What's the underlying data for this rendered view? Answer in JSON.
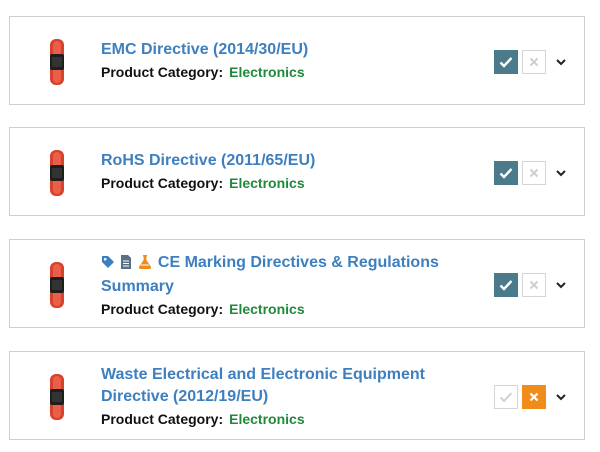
{
  "items": [
    {
      "title": "EMC Directive (2014/30/EU)",
      "category_label": "Product Category:",
      "category_value": "Electronics",
      "approved": true,
      "icons": []
    },
    {
      "title": "RoHS Directive (2011/65/EU)",
      "category_label": "Product Category:",
      "category_value": "Electronics",
      "approved": true,
      "icons": []
    },
    {
      "title": "CE Marking Directives & Regulations Summary",
      "category_label": "Product Category:",
      "category_value": "Electronics",
      "approved": true,
      "icons": [
        "tag-icon",
        "document-icon",
        "flask-icon"
      ]
    },
    {
      "title": "Waste Electrical and Electronic Equipment Directive (2012/19/EU)",
      "category_label": "Product Category:",
      "category_value": "Electronics",
      "approved": false,
      "icons": []
    }
  ],
  "colors": {
    "link": "#3d7fbf",
    "category_value": "#1f8a3a",
    "approve_active": "#4b7a8a",
    "reject_active": "#f08c1a",
    "border": "#cfcfcf"
  }
}
